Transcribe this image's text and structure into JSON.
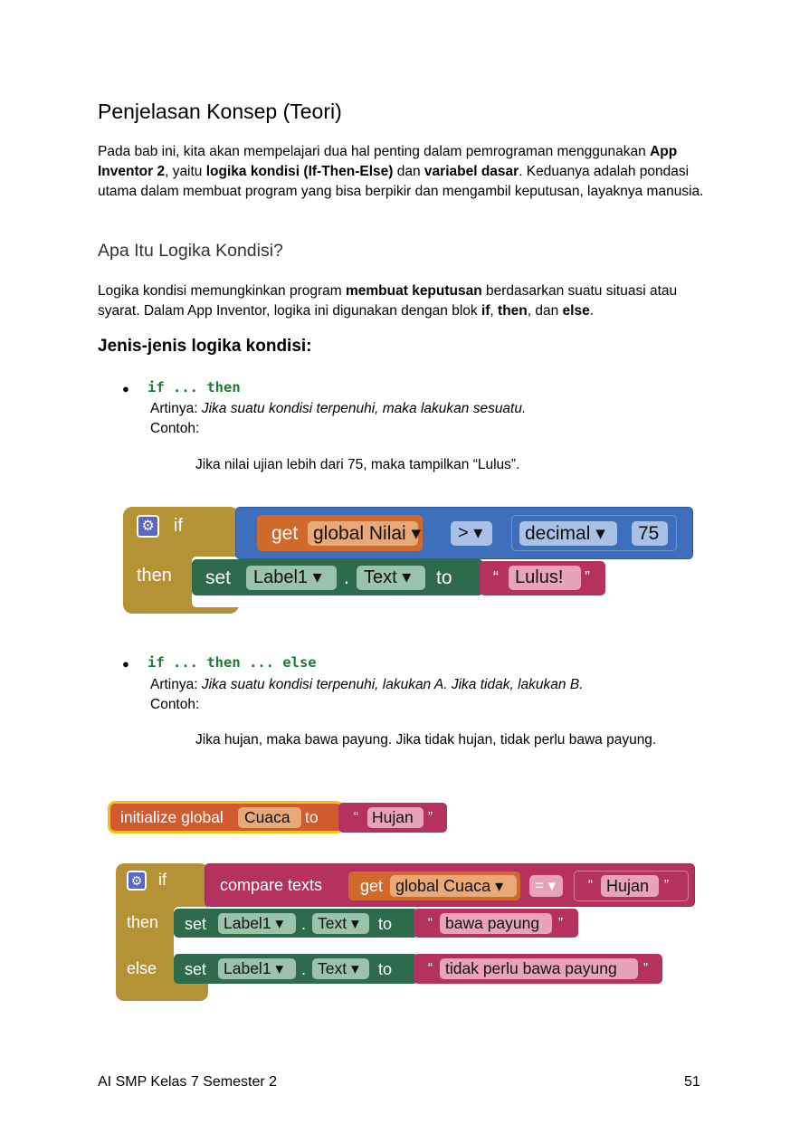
{
  "heading": "Penjelasan Konsep (Teori)",
  "intro": {
    "p1": "Pada bab ini, kita akan mempelajari dua hal penting dalam pemrograman menggunakan",
    "b1": "App Inventor 2",
    "t2": ", yaitu ",
    "b2": "logika kondisi (If-Then-Else)",
    "t3": " dan ",
    "b3": "variabel dasar",
    "t4": ". Keduanya adalah pondasi utama dalam membuat program yang bisa berpikir dan mengambil keputusan, layaknya manusia."
  },
  "subheading": "Apa Itu Logika Kondisi?",
  "logika": {
    "t1": "Logika kondisi memungkinkan program ",
    "b1": "membuat keputusan",
    "t2": " berdasarkan suatu situasi atau syarat. Dalam App Inventor, logika ini digunakan dengan blok ",
    "b2": "if",
    "t3": ", ",
    "b3": "then",
    "t4": ", dan ",
    "b4": "else",
    "t5": "."
  },
  "jenis_heading": "Jenis-jenis logika kondisi:",
  "items": [
    {
      "code": "if ... then",
      "artinya_label": "Artinya: ",
      "artinya": "Jika suatu kondisi terpenuhi, maka lakukan sesuatu.",
      "contoh": "Contoh:",
      "example": "Jika nilai ujian lebih dari 75, maka tampilkan “Lulus”."
    },
    {
      "code": "if ... then ... else",
      "artinya_label": "Artinya: ",
      "artinya": "Jika suatu kondisi terpenuhi, lakukan A. Jika tidak, lakukan B.",
      "contoh": "Contoh:",
      "example": "Jika hujan, maka bawa payung. Jika tidak hujan, tidak perlu bawa payung."
    }
  ],
  "block1": {
    "if": "if",
    "then": "then",
    "get": "get",
    "var": "global Nilai ▾",
    "op": "> ▾",
    "decimal": "decimal ▾",
    "num": "75",
    "set": "set",
    "comp": "Label1 ▾",
    "dot": ".",
    "prop": "Text ▾",
    "to": "to",
    "oq": "“",
    "str": "Lulus!",
    "cq": "”"
  },
  "block2": {
    "init": "initialize global",
    "varname": "Cuaca",
    "to": "to",
    "oq": "“",
    "init_str": "Hujan",
    "cq": "”",
    "if": "if",
    "then": "then",
    "else": "else",
    "compare": "compare texts",
    "get": "get",
    "var": "global Cuaca ▾",
    "op": "= ▾",
    "cmp_str": "Hujan",
    "set": "set",
    "comp": "Label1 ▾",
    "dot": ".",
    "prop": "Text ▾",
    "str_then": "bawa payung",
    "str_else": "tidak perlu bawa payung"
  },
  "footer": {
    "left": "AI SMP Kelas 7 Semester 2",
    "right": "51"
  },
  "colors": {
    "control": "#b39336",
    "math": "#3e6fbd",
    "variable_get": "#d0692c",
    "set": "#2e6b4a",
    "text": "#b5315f",
    "init": "#d25a2e",
    "code_green": "#1e7b36"
  }
}
